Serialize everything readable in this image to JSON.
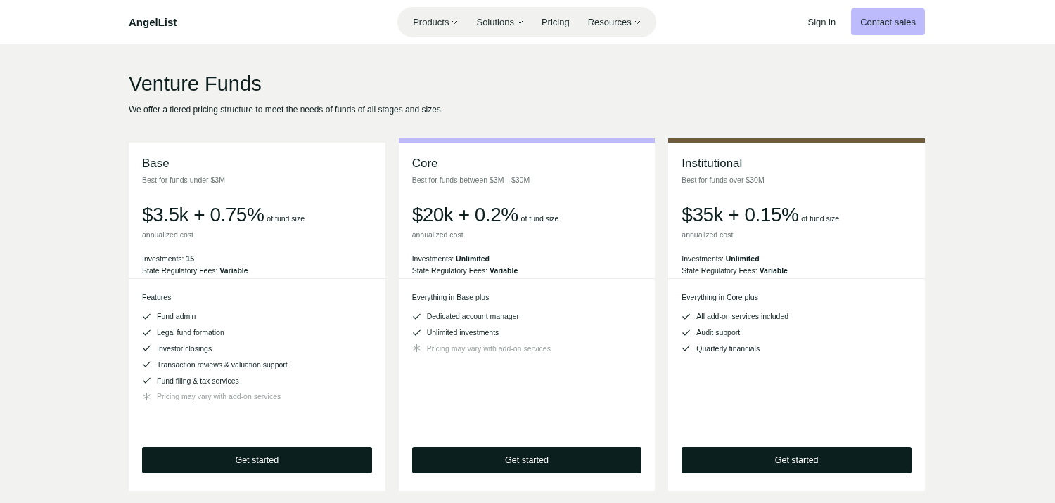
{
  "header": {
    "logo": "AngelList",
    "nav": [
      {
        "label": "Products",
        "dropdown": true
      },
      {
        "label": "Solutions",
        "dropdown": true
      },
      {
        "label": "Pricing",
        "dropdown": false
      },
      {
        "label": "Resources",
        "dropdown": true
      }
    ],
    "sign_in": "Sign in",
    "cta": "Contact sales"
  },
  "page": {
    "title": "Venture Funds",
    "subtitle": "We offer a tiered pricing structure to meet the needs of funds of all stages and sizes."
  },
  "plans": [
    {
      "name": "Base",
      "tagline": "Best for funds under $3M",
      "price": "$3.5k + 0.75%",
      "price_suffix": "of fund size",
      "price_note": "annualized cost",
      "stats": [
        "Investments: **15**",
        "State Regulatory Fees: **Variable**"
      ],
      "features_title": "Features",
      "features": [
        {
          "kind": "check",
          "text": "Fund admin"
        },
        {
          "kind": "check",
          "text": "Legal fund formation"
        },
        {
          "kind": "check",
          "text": "Investor closings"
        },
        {
          "kind": "check",
          "text": "Transaction reviews & valuation support"
        },
        {
          "kind": "check",
          "text": "Fund filing & tax services"
        },
        {
          "kind": "note",
          "text": "Pricing may vary with add-on services"
        }
      ],
      "button": "Get started"
    },
    {
      "name": "Core",
      "color": "#bdb9fb",
      "tagline": "Best for funds between $3M—$30M",
      "price": "$20k + 0.2%",
      "price_suffix": "of fund size",
      "price_note": "annualized cost",
      "stats": [
        "Investments: **Unlimited**",
        "State Regulatory Fees: **Variable**"
      ],
      "features_title": "Everything in Base plus",
      "features": [
        {
          "kind": "check",
          "text": "Dedicated account manager"
        },
        {
          "kind": "check",
          "text": "Unlimited investments"
        },
        {
          "kind": "note",
          "text": "Pricing may vary with add-on services"
        }
      ],
      "button": "Get started"
    },
    {
      "name": "Institutional",
      "color": "#6e5c3c",
      "tagline": "Best for funds over $30M",
      "price": "$35k + 0.15%",
      "price_suffix": "of fund size",
      "price_note": "annualized cost",
      "stats": [
        "Investments: **Unlimited**",
        "State Regulatory Fees: **Variable**"
      ],
      "features_title": "Everything in Core plus",
      "features": [
        {
          "kind": "check",
          "text": "All add-on services included"
        },
        {
          "kind": "check",
          "text": "Audit support"
        },
        {
          "kind": "check",
          "text": "Quarterly financials"
        }
      ],
      "button": "Get started"
    }
  ]
}
